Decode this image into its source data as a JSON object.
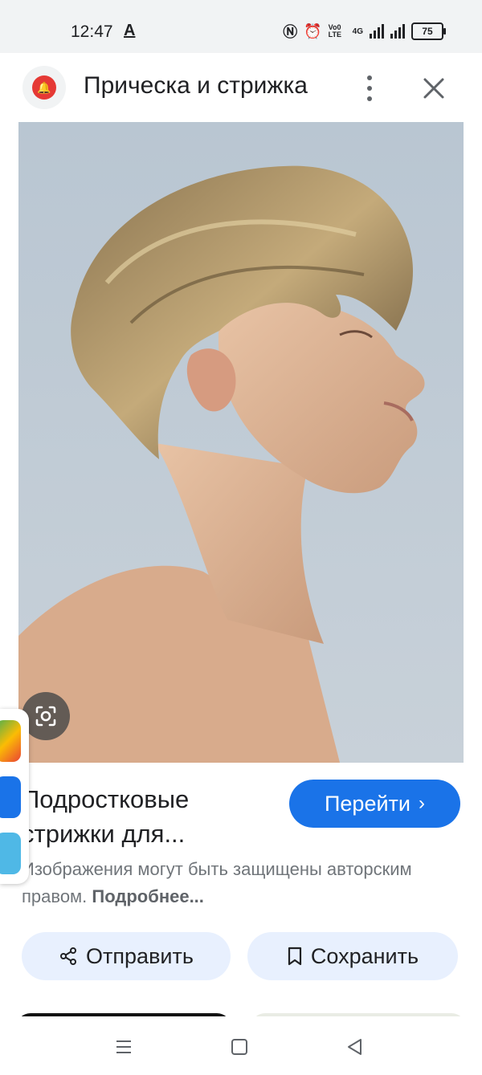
{
  "status_bar": {
    "time": "12:47",
    "notification_letter": "A",
    "network": "4G",
    "volte": "Vo0 LTE",
    "battery": "75"
  },
  "header": {
    "title": "Прическа и стрижка"
  },
  "result": {
    "title_line1": "Подростковые",
    "title_line2": "стрижки для...",
    "visit_label": "Перейти",
    "copyright_text": "Изображения могут быть защищены авторским правом.",
    "more_link": "Подробнее..."
  },
  "actions": {
    "share_label": "Отправить",
    "save_label": "Сохранить"
  },
  "colors": {
    "accent": "#1a73e8",
    "chip_bg": "#e8f0fe",
    "site_icon": "#e53935"
  }
}
